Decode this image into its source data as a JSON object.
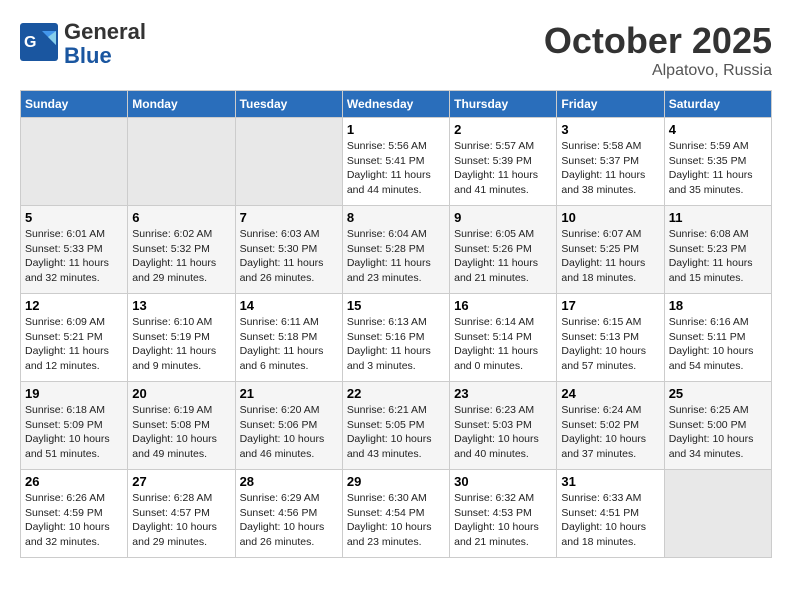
{
  "header": {
    "logo_general": "General",
    "logo_blue": "Blue",
    "month_title": "October 2025",
    "location": "Alpatovo, Russia"
  },
  "days_of_week": [
    "Sunday",
    "Monday",
    "Tuesday",
    "Wednesday",
    "Thursday",
    "Friday",
    "Saturday"
  ],
  "weeks": [
    {
      "days": [
        {
          "num": "",
          "info": ""
        },
        {
          "num": "",
          "info": ""
        },
        {
          "num": "",
          "info": ""
        },
        {
          "num": "1",
          "info": "Sunrise: 5:56 AM\nSunset: 5:41 PM\nDaylight: 11 hours and 44 minutes."
        },
        {
          "num": "2",
          "info": "Sunrise: 5:57 AM\nSunset: 5:39 PM\nDaylight: 11 hours and 41 minutes."
        },
        {
          "num": "3",
          "info": "Sunrise: 5:58 AM\nSunset: 5:37 PM\nDaylight: 11 hours and 38 minutes."
        },
        {
          "num": "4",
          "info": "Sunrise: 5:59 AM\nSunset: 5:35 PM\nDaylight: 11 hours and 35 minutes."
        }
      ]
    },
    {
      "days": [
        {
          "num": "5",
          "info": "Sunrise: 6:01 AM\nSunset: 5:33 PM\nDaylight: 11 hours and 32 minutes."
        },
        {
          "num": "6",
          "info": "Sunrise: 6:02 AM\nSunset: 5:32 PM\nDaylight: 11 hours and 29 minutes."
        },
        {
          "num": "7",
          "info": "Sunrise: 6:03 AM\nSunset: 5:30 PM\nDaylight: 11 hours and 26 minutes."
        },
        {
          "num": "8",
          "info": "Sunrise: 6:04 AM\nSunset: 5:28 PM\nDaylight: 11 hours and 23 minutes."
        },
        {
          "num": "9",
          "info": "Sunrise: 6:05 AM\nSunset: 5:26 PM\nDaylight: 11 hours and 21 minutes."
        },
        {
          "num": "10",
          "info": "Sunrise: 6:07 AM\nSunset: 5:25 PM\nDaylight: 11 hours and 18 minutes."
        },
        {
          "num": "11",
          "info": "Sunrise: 6:08 AM\nSunset: 5:23 PM\nDaylight: 11 hours and 15 minutes."
        }
      ]
    },
    {
      "days": [
        {
          "num": "12",
          "info": "Sunrise: 6:09 AM\nSunset: 5:21 PM\nDaylight: 11 hours and 12 minutes."
        },
        {
          "num": "13",
          "info": "Sunrise: 6:10 AM\nSunset: 5:19 PM\nDaylight: 11 hours and 9 minutes."
        },
        {
          "num": "14",
          "info": "Sunrise: 6:11 AM\nSunset: 5:18 PM\nDaylight: 11 hours and 6 minutes."
        },
        {
          "num": "15",
          "info": "Sunrise: 6:13 AM\nSunset: 5:16 PM\nDaylight: 11 hours and 3 minutes."
        },
        {
          "num": "16",
          "info": "Sunrise: 6:14 AM\nSunset: 5:14 PM\nDaylight: 11 hours and 0 minutes."
        },
        {
          "num": "17",
          "info": "Sunrise: 6:15 AM\nSunset: 5:13 PM\nDaylight: 10 hours and 57 minutes."
        },
        {
          "num": "18",
          "info": "Sunrise: 6:16 AM\nSunset: 5:11 PM\nDaylight: 10 hours and 54 minutes."
        }
      ]
    },
    {
      "days": [
        {
          "num": "19",
          "info": "Sunrise: 6:18 AM\nSunset: 5:09 PM\nDaylight: 10 hours and 51 minutes."
        },
        {
          "num": "20",
          "info": "Sunrise: 6:19 AM\nSunset: 5:08 PM\nDaylight: 10 hours and 49 minutes."
        },
        {
          "num": "21",
          "info": "Sunrise: 6:20 AM\nSunset: 5:06 PM\nDaylight: 10 hours and 46 minutes."
        },
        {
          "num": "22",
          "info": "Sunrise: 6:21 AM\nSunset: 5:05 PM\nDaylight: 10 hours and 43 minutes."
        },
        {
          "num": "23",
          "info": "Sunrise: 6:23 AM\nSunset: 5:03 PM\nDaylight: 10 hours and 40 minutes."
        },
        {
          "num": "24",
          "info": "Sunrise: 6:24 AM\nSunset: 5:02 PM\nDaylight: 10 hours and 37 minutes."
        },
        {
          "num": "25",
          "info": "Sunrise: 6:25 AM\nSunset: 5:00 PM\nDaylight: 10 hours and 34 minutes."
        }
      ]
    },
    {
      "days": [
        {
          "num": "26",
          "info": "Sunrise: 6:26 AM\nSunset: 4:59 PM\nDaylight: 10 hours and 32 minutes."
        },
        {
          "num": "27",
          "info": "Sunrise: 6:28 AM\nSunset: 4:57 PM\nDaylight: 10 hours and 29 minutes."
        },
        {
          "num": "28",
          "info": "Sunrise: 6:29 AM\nSunset: 4:56 PM\nDaylight: 10 hours and 26 minutes."
        },
        {
          "num": "29",
          "info": "Sunrise: 6:30 AM\nSunset: 4:54 PM\nDaylight: 10 hours and 23 minutes."
        },
        {
          "num": "30",
          "info": "Sunrise: 6:32 AM\nSunset: 4:53 PM\nDaylight: 10 hours and 21 minutes."
        },
        {
          "num": "31",
          "info": "Sunrise: 6:33 AM\nSunset: 4:51 PM\nDaylight: 10 hours and 18 minutes."
        },
        {
          "num": "",
          "info": ""
        }
      ]
    }
  ]
}
